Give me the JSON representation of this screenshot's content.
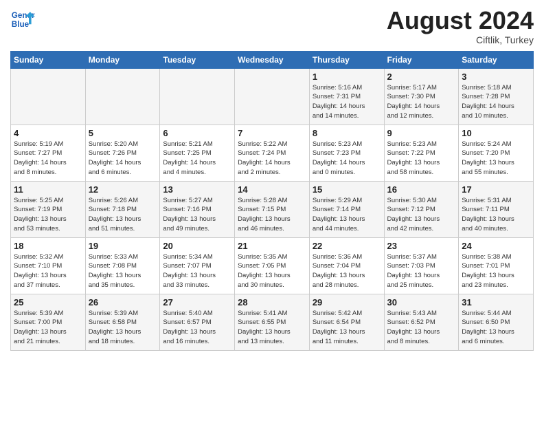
{
  "header": {
    "logo_line1": "General",
    "logo_line2": "Blue",
    "month": "August 2024",
    "location": "Ciftlik, Turkey"
  },
  "days_of_week": [
    "Sunday",
    "Monday",
    "Tuesday",
    "Wednesday",
    "Thursday",
    "Friday",
    "Saturday"
  ],
  "weeks": [
    [
      {
        "day": "",
        "info": ""
      },
      {
        "day": "",
        "info": ""
      },
      {
        "day": "",
        "info": ""
      },
      {
        "day": "",
        "info": ""
      },
      {
        "day": "1",
        "info": "Sunrise: 5:16 AM\nSunset: 7:31 PM\nDaylight: 14 hours\nand 14 minutes."
      },
      {
        "day": "2",
        "info": "Sunrise: 5:17 AM\nSunset: 7:30 PM\nDaylight: 14 hours\nand 12 minutes."
      },
      {
        "day": "3",
        "info": "Sunrise: 5:18 AM\nSunset: 7:28 PM\nDaylight: 14 hours\nand 10 minutes."
      }
    ],
    [
      {
        "day": "4",
        "info": "Sunrise: 5:19 AM\nSunset: 7:27 PM\nDaylight: 14 hours\nand 8 minutes."
      },
      {
        "day": "5",
        "info": "Sunrise: 5:20 AM\nSunset: 7:26 PM\nDaylight: 14 hours\nand 6 minutes."
      },
      {
        "day": "6",
        "info": "Sunrise: 5:21 AM\nSunset: 7:25 PM\nDaylight: 14 hours\nand 4 minutes."
      },
      {
        "day": "7",
        "info": "Sunrise: 5:22 AM\nSunset: 7:24 PM\nDaylight: 14 hours\nand 2 minutes."
      },
      {
        "day": "8",
        "info": "Sunrise: 5:23 AM\nSunset: 7:23 PM\nDaylight: 14 hours\nand 0 minutes."
      },
      {
        "day": "9",
        "info": "Sunrise: 5:23 AM\nSunset: 7:22 PM\nDaylight: 13 hours\nand 58 minutes."
      },
      {
        "day": "10",
        "info": "Sunrise: 5:24 AM\nSunset: 7:20 PM\nDaylight: 13 hours\nand 55 minutes."
      }
    ],
    [
      {
        "day": "11",
        "info": "Sunrise: 5:25 AM\nSunset: 7:19 PM\nDaylight: 13 hours\nand 53 minutes."
      },
      {
        "day": "12",
        "info": "Sunrise: 5:26 AM\nSunset: 7:18 PM\nDaylight: 13 hours\nand 51 minutes."
      },
      {
        "day": "13",
        "info": "Sunrise: 5:27 AM\nSunset: 7:16 PM\nDaylight: 13 hours\nand 49 minutes."
      },
      {
        "day": "14",
        "info": "Sunrise: 5:28 AM\nSunset: 7:15 PM\nDaylight: 13 hours\nand 46 minutes."
      },
      {
        "day": "15",
        "info": "Sunrise: 5:29 AM\nSunset: 7:14 PM\nDaylight: 13 hours\nand 44 minutes."
      },
      {
        "day": "16",
        "info": "Sunrise: 5:30 AM\nSunset: 7:12 PM\nDaylight: 13 hours\nand 42 minutes."
      },
      {
        "day": "17",
        "info": "Sunrise: 5:31 AM\nSunset: 7:11 PM\nDaylight: 13 hours\nand 40 minutes."
      }
    ],
    [
      {
        "day": "18",
        "info": "Sunrise: 5:32 AM\nSunset: 7:10 PM\nDaylight: 13 hours\nand 37 minutes."
      },
      {
        "day": "19",
        "info": "Sunrise: 5:33 AM\nSunset: 7:08 PM\nDaylight: 13 hours\nand 35 minutes."
      },
      {
        "day": "20",
        "info": "Sunrise: 5:34 AM\nSunset: 7:07 PM\nDaylight: 13 hours\nand 33 minutes."
      },
      {
        "day": "21",
        "info": "Sunrise: 5:35 AM\nSunset: 7:05 PM\nDaylight: 13 hours\nand 30 minutes."
      },
      {
        "day": "22",
        "info": "Sunrise: 5:36 AM\nSunset: 7:04 PM\nDaylight: 13 hours\nand 28 minutes."
      },
      {
        "day": "23",
        "info": "Sunrise: 5:37 AM\nSunset: 7:03 PM\nDaylight: 13 hours\nand 25 minutes."
      },
      {
        "day": "24",
        "info": "Sunrise: 5:38 AM\nSunset: 7:01 PM\nDaylight: 13 hours\nand 23 minutes."
      }
    ],
    [
      {
        "day": "25",
        "info": "Sunrise: 5:39 AM\nSunset: 7:00 PM\nDaylight: 13 hours\nand 21 minutes."
      },
      {
        "day": "26",
        "info": "Sunrise: 5:39 AM\nSunset: 6:58 PM\nDaylight: 13 hours\nand 18 minutes."
      },
      {
        "day": "27",
        "info": "Sunrise: 5:40 AM\nSunset: 6:57 PM\nDaylight: 13 hours\nand 16 minutes."
      },
      {
        "day": "28",
        "info": "Sunrise: 5:41 AM\nSunset: 6:55 PM\nDaylight: 13 hours\nand 13 minutes."
      },
      {
        "day": "29",
        "info": "Sunrise: 5:42 AM\nSunset: 6:54 PM\nDaylight: 13 hours\nand 11 minutes."
      },
      {
        "day": "30",
        "info": "Sunrise: 5:43 AM\nSunset: 6:52 PM\nDaylight: 13 hours\nand 8 minutes."
      },
      {
        "day": "31",
        "info": "Sunrise: 5:44 AM\nSunset: 6:50 PM\nDaylight: 13 hours\nand 6 minutes."
      }
    ]
  ]
}
